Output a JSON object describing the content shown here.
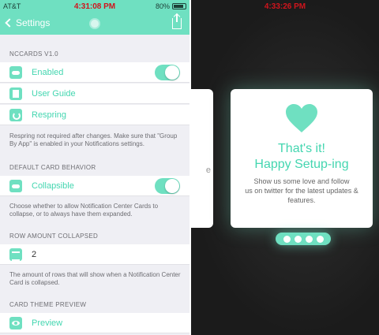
{
  "status_left": {
    "carrier": "AT&T",
    "time": "4:31:08 PM",
    "battery": "80%"
  },
  "navbar": {
    "back_label": "Settings"
  },
  "sections": {
    "nccards": {
      "header": "NCCARDS V1.0",
      "items": [
        {
          "label": "Enabled",
          "toggle_on": true
        },
        {
          "label": "User Guide"
        },
        {
          "label": "Respring"
        }
      ],
      "footer": "Respring not required after changes. Make sure that \"Group By App\" is enabled in your Notifications settings."
    },
    "default_card": {
      "header": "DEFAULT CARD BEHAVIOR",
      "items": [
        {
          "label": "Collapsible",
          "toggle_on": true
        }
      ],
      "footer": "Choose whether to allow Notification Center Cards to collapse, or to always have them expanded."
    },
    "row_amount": {
      "header": "ROW AMOUNT COLLAPSED",
      "value": "2",
      "footer": "The amount of rows that will show when a Notification Center Card is collapsed."
    },
    "theme_preview": {
      "header": "CARD THEME PREVIEW",
      "items": [
        {
          "label": "Preview"
        }
      ]
    }
  },
  "right": {
    "time": "4:33:26 PM",
    "left_card_char": "e",
    "card": {
      "title_line1": "That's it!",
      "title_line2": "Happy Setup-ing",
      "sub_line1": "Show us some love and follow",
      "sub_line2": "us on twitter for the latest updates &",
      "sub_line3": "features."
    },
    "pager_pages": 4
  },
  "colors": {
    "accent": "#6fe0c1",
    "accent_text": "#44d6b0",
    "time_red": "#d0141c",
    "dark_bg": "#1b1b1b"
  }
}
